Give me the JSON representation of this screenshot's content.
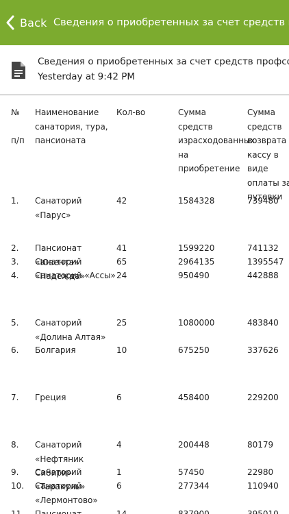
{
  "header": {
    "back_label": "Back",
    "title": "Сведения о приобретенных за счет средств профсоюзного бюджета"
  },
  "file": {
    "title": "Сведения о приобретенных за счет средств профсоюзног…",
    "timestamp": "Yesterday at 9:42 PM",
    "icon": "document-icon"
  },
  "table": {
    "headers": [
      "№\n\nп/п",
      "Наименование санатория, тура, пансионата",
      "Кол-во",
      "Сумма средств израсходованных на приобретение",
      "Сумма средств возврата в кассу в виде оплаты за путевки"
    ],
    "rows": [
      [
        "1.",
        "Санаторий «Парус»",
        "42",
        "1584328",
        "739480"
      ],
      [
        "2.",
        "Пансионат «Ювента»",
        "41",
        "1599220",
        "741132"
      ],
      [
        "3.",
        "Санаторий «Надежда»",
        "65",
        "2964135",
        "1395547"
      ],
      [
        "4.",
        "Санаторий «Ассы»",
        "24",
        "950490",
        "442888"
      ],
      [
        "5.",
        "Санаторий «Долина Алтая»",
        "25",
        "1080000",
        "483840"
      ],
      [
        "6.",
        "Болгария",
        "10",
        "675250",
        "337626"
      ],
      [
        "7.",
        "Греция",
        "6",
        "458400",
        "229200"
      ],
      [
        "8.",
        "Санаторий «Нефтяник Сибири»",
        "4",
        "200448",
        "80179"
      ],
      [
        "9.",
        "Санаторий «Таракуль»",
        "1",
        "57450",
        "22980"
      ],
      [
        "10.",
        "Санаторий «Лермонтово»",
        "6",
        "277344",
        "110940"
      ],
      [
        "11.",
        "Пансионат",
        "14",
        "837900",
        "395010"
      ]
    ]
  }
}
